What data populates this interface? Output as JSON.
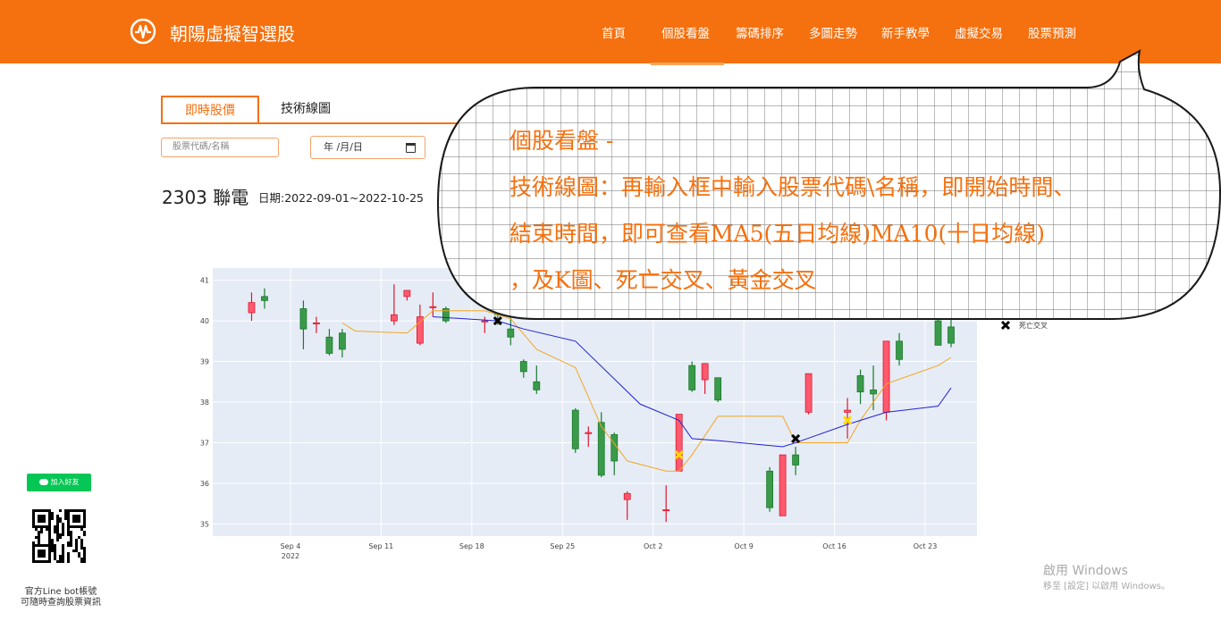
{
  "brand": {
    "name": "朝陽虛擬智選股",
    "icon": "pulse-logo-icon"
  },
  "nav": {
    "items": [
      "首頁",
      "個股看盤",
      "籌碼排序",
      "多圖走勢",
      "新手教學",
      "虛擬交易",
      "股票預測"
    ],
    "active": "個股看盤"
  },
  "tabs": {
    "realtime": "即時股價",
    "technical": "技術線圖"
  },
  "form": {
    "stock_placeholder": "股票代碼/名稱",
    "date_value": "年 /月/日"
  },
  "stock": {
    "title": "2303 聯電",
    "range": "日期:2022-09-01~2022-10-25"
  },
  "callout": {
    "lines": [
      "個股看盤 -",
      "技術線圖：再輸入框中輸入股票代碼\\名稱，即開始時間、",
      "結束時間，即可查看MA5(五日均線)MA10(十日均線)",
      "，及K圖、死亡交叉、黃金交叉"
    ]
  },
  "colors": {
    "brand": "#f5700e",
    "up": "#ff5a6e",
    "down": "#3a9a4a",
    "ma5": "#f5a623",
    "ma10": "#2323d0",
    "plot_bg": "#e5ecf6"
  },
  "chart_data": {
    "type": "candlestick",
    "x_axis": {
      "ticks": [
        "Sep 4",
        "Sep 11",
        "Sep 18",
        "Sep 25",
        "Oct 2",
        "Oct 9",
        "Oct 16",
        "Oct 23"
      ],
      "year_label": "2022",
      "range": [
        "2022-09-01",
        "2022-10-25"
      ]
    },
    "y_axis": {
      "ticks": [
        35,
        36,
        37,
        38,
        39,
        40,
        41
      ],
      "range": [
        34.7,
        41.3
      ]
    },
    "candles": [
      {
        "date": "2022-09-01",
        "open": 40.2,
        "high": 40.7,
        "low": 40.0,
        "close": 40.45
      },
      {
        "date": "2022-09-02",
        "open": 40.6,
        "high": 40.8,
        "low": 40.3,
        "close": 40.5
      },
      {
        "date": "2022-09-05",
        "open": 40.3,
        "high": 40.5,
        "low": 39.3,
        "close": 39.8
      },
      {
        "date": "2022-09-06",
        "open": 39.95,
        "high": 40.1,
        "low": 39.7,
        "close": 39.95
      },
      {
        "date": "2022-09-07",
        "open": 39.6,
        "high": 39.8,
        "low": 39.15,
        "close": 39.2
      },
      {
        "date": "2022-09-08",
        "open": 39.7,
        "high": 39.8,
        "low": 39.1,
        "close": 39.3
      },
      {
        "date": "2022-09-12",
        "open": 40.0,
        "high": 40.9,
        "low": 39.9,
        "close": 40.15
      },
      {
        "date": "2022-09-13",
        "open": 40.6,
        "high": 40.75,
        "low": 40.5,
        "close": 40.75
      },
      {
        "date": "2022-09-14",
        "open": 39.45,
        "high": 40.4,
        "low": 39.4,
        "close": 40.1
      },
      {
        "date": "2022-09-15",
        "open": 40.35,
        "high": 40.7,
        "low": 40.1,
        "close": 40.35
      },
      {
        "date": "2022-09-16",
        "open": 40.3,
        "high": 40.35,
        "low": 39.95,
        "close": 40.0
      },
      {
        "date": "2022-09-19",
        "open": 40.0,
        "high": 40.1,
        "low": 39.7,
        "close": 40.0
      },
      {
        "date": "2022-09-20",
        "open": 40.2,
        "high": 40.4,
        "low": 39.9,
        "close": 40.15
      },
      {
        "date": "2022-09-21",
        "open": 39.8,
        "high": 40.1,
        "low": 39.4,
        "close": 39.6
      },
      {
        "date": "2022-09-22",
        "open": 39.0,
        "high": 39.05,
        "low": 38.6,
        "close": 38.75
      },
      {
        "date": "2022-09-23",
        "open": 38.5,
        "high": 38.9,
        "low": 38.2,
        "close": 38.3
      },
      {
        "date": "2022-09-26",
        "open": 37.8,
        "high": 37.85,
        "low": 36.75,
        "close": 36.85
      },
      {
        "date": "2022-09-27",
        "open": 37.25,
        "high": 37.4,
        "low": 36.9,
        "close": 37.25
      },
      {
        "date": "2022-09-28",
        "open": 37.5,
        "high": 37.75,
        "low": 36.15,
        "close": 36.2
      },
      {
        "date": "2022-09-29",
        "open": 37.2,
        "high": 37.25,
        "low": 36.2,
        "close": 36.55
      },
      {
        "date": "2022-09-30",
        "open": 35.6,
        "high": 35.8,
        "low": 35.1,
        "close": 35.75
      },
      {
        "date": "2022-10-03",
        "open": 35.35,
        "high": 35.95,
        "low": 35.05,
        "close": 35.35
      },
      {
        "date": "2022-10-04",
        "open": 36.3,
        "high": 37.7,
        "low": 36.3,
        "close": 37.7
      },
      {
        "date": "2022-10-05",
        "open": 38.9,
        "high": 39.0,
        "low": 38.25,
        "close": 38.3
      },
      {
        "date": "2022-10-06",
        "open": 38.55,
        "high": 38.95,
        "low": 38.2,
        "close": 38.95
      },
      {
        "date": "2022-10-07",
        "open": 38.6,
        "high": 38.6,
        "low": 38.0,
        "close": 38.05
      },
      {
        "date": "2022-10-11",
        "open": 36.3,
        "high": 36.4,
        "low": 35.3,
        "close": 35.4
      },
      {
        "date": "2022-10-12",
        "open": 35.2,
        "high": 36.7,
        "low": 35.2,
        "close": 36.7
      },
      {
        "date": "2022-10-13",
        "open": 36.7,
        "high": 36.9,
        "low": 36.2,
        "close": 36.45
      },
      {
        "date": "2022-10-14",
        "open": 37.75,
        "high": 38.7,
        "low": 37.7,
        "close": 38.7
      },
      {
        "date": "2022-10-17",
        "open": 37.75,
        "high": 38.1,
        "low": 37.1,
        "close": 37.8
      },
      {
        "date": "2022-10-18",
        "open": 38.65,
        "high": 38.8,
        "low": 37.95,
        "close": 38.25
      },
      {
        "date": "2022-10-19",
        "open": 38.3,
        "high": 38.9,
        "low": 37.8,
        "close": 38.2
      },
      {
        "date": "2022-10-20",
        "open": 37.75,
        "high": 39.5,
        "low": 37.55,
        "close": 39.5
      },
      {
        "date": "2022-10-21",
        "open": 39.5,
        "high": 39.7,
        "low": 38.9,
        "close": 39.05
      },
      {
        "date": "2022-10-24",
        "open": 40.0,
        "high": 40.1,
        "low": 39.4,
        "close": 39.4
      },
      {
        "date": "2022-10-25",
        "open": 39.85,
        "high": 40.05,
        "low": 39.35,
        "close": 39.45
      }
    ],
    "ma5": [
      {
        "date": "2022-09-08",
        "value": 39.95
      },
      {
        "date": "2022-09-09",
        "value": 39.75
      },
      {
        "date": "2022-09-13",
        "value": 39.7
      },
      {
        "date": "2022-09-15",
        "value": 40.25
      },
      {
        "date": "2022-09-19",
        "value": 40.25
      },
      {
        "date": "2022-09-21",
        "value": 40.05
      },
      {
        "date": "2022-09-23",
        "value": 39.3
      },
      {
        "date": "2022-09-26",
        "value": 38.85
      },
      {
        "date": "2022-09-28",
        "value": 37.4
      },
      {
        "date": "2022-09-30",
        "value": 36.55
      },
      {
        "date": "2022-10-03",
        "value": 36.3
      },
      {
        "date": "2022-10-04",
        "value": 36.3
      },
      {
        "date": "2022-10-05",
        "value": 36.7
      },
      {
        "date": "2022-10-07",
        "value": 37.65
      },
      {
        "date": "2022-10-12",
        "value": 37.65
      },
      {
        "date": "2022-10-13",
        "value": 37.0
      },
      {
        "date": "2022-10-14",
        "value": 37.0
      },
      {
        "date": "2022-10-17",
        "value": 37.0
      },
      {
        "date": "2022-10-18",
        "value": 37.55
      },
      {
        "date": "2022-10-20",
        "value": 38.45
      },
      {
        "date": "2022-10-24",
        "value": 38.9
      },
      {
        "date": "2022-10-25",
        "value": 39.1
      }
    ],
    "ma10": [
      {
        "date": "2022-09-15",
        "value": 40.1
      },
      {
        "date": "2022-09-20",
        "value": 40.0
      },
      {
        "date": "2022-09-22",
        "value": 39.8
      },
      {
        "date": "2022-09-26",
        "value": 39.5
      },
      {
        "date": "2022-10-01",
        "value": 37.95
      },
      {
        "date": "2022-10-04",
        "value": 37.55
      },
      {
        "date": "2022-10-05",
        "value": 37.1
      },
      {
        "date": "2022-10-07",
        "value": 37.05
      },
      {
        "date": "2022-10-12",
        "value": 36.9
      },
      {
        "date": "2022-10-13",
        "value": 37.0
      },
      {
        "date": "2022-10-17",
        "value": 37.45
      },
      {
        "date": "2022-10-20",
        "value": 37.75
      },
      {
        "date": "2022-10-24",
        "value": 37.9
      },
      {
        "date": "2022-10-25",
        "value": 38.35
      }
    ],
    "death_cross": [
      {
        "date": "2022-09-20",
        "value": 40.0
      },
      {
        "date": "2022-10-13",
        "value": 37.1
      }
    ],
    "golden_cross": [
      {
        "date": "2022-10-04",
        "value": 36.7
      },
      {
        "date": "2022-10-17",
        "value": 37.55
      }
    ],
    "legend": {
      "death_cross_label": "死亡交叉"
    }
  },
  "line_widget": {
    "button_label": "加入好友",
    "caption_line1": "官方Line bot帳號",
    "caption_line2": "可隨時查詢股票資訊"
  },
  "watermark": {
    "title": "啟用 Windows",
    "subtitle": "移至 [設定] 以啟用 Windows。"
  }
}
